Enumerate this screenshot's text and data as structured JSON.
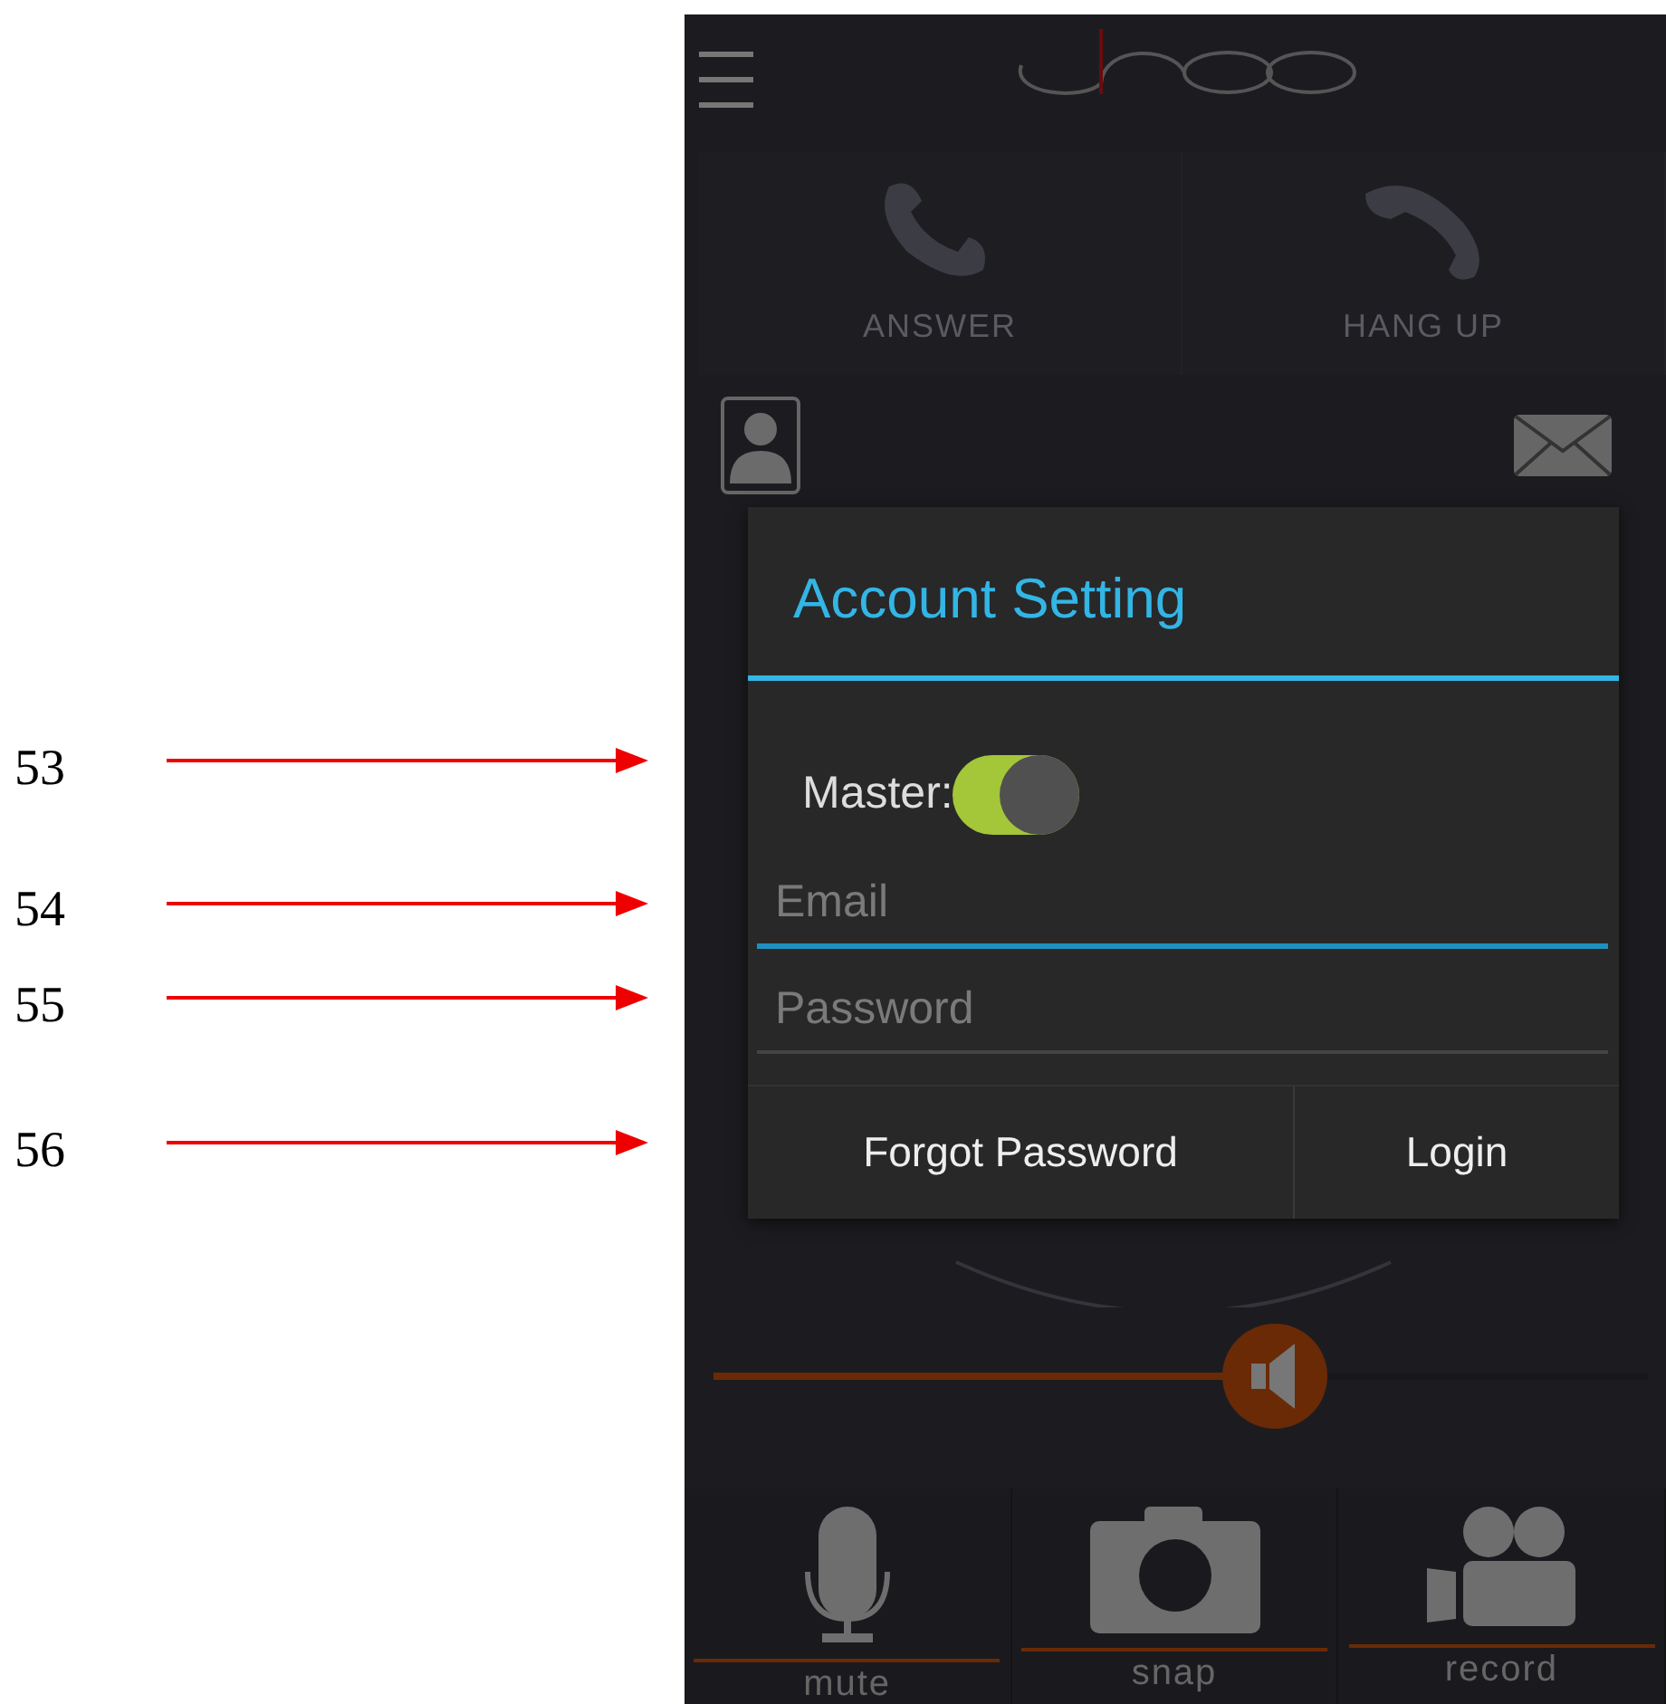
{
  "annotations": [
    {
      "label": "53"
    },
    {
      "label": "54"
    },
    {
      "label": "55"
    },
    {
      "label": "56"
    }
  ],
  "app": {
    "call_buttons": [
      {
        "label": "ANSWER",
        "kind": "answer"
      },
      {
        "label": "HANG UP",
        "kind": "hangup"
      }
    ],
    "volume": {
      "level": 0.6
    },
    "actions": [
      {
        "label": "mute",
        "kind": "mic"
      },
      {
        "label": "snap",
        "kind": "camera"
      },
      {
        "label": "record",
        "kind": "video"
      }
    ]
  },
  "dialog": {
    "title": "Account Setting",
    "master": {
      "label": "Master:",
      "on": true
    },
    "fields": [
      {
        "placeholder": "Email",
        "focused": true
      },
      {
        "placeholder": "Password",
        "focused": false
      }
    ],
    "buttons": [
      "Forgot Password",
      "Login"
    ]
  }
}
